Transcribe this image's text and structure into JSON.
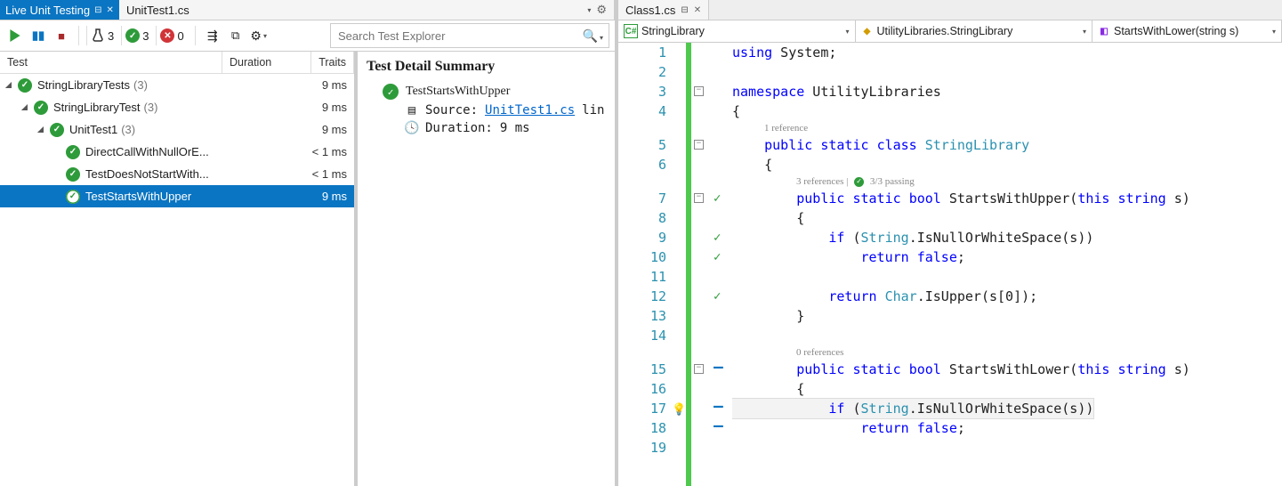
{
  "tabs": {
    "left_active": "Live Unit Testing",
    "left_inactive": "UnitTest1.cs",
    "right_file": "Class1.cs"
  },
  "toolbar": {
    "flask_count": "3",
    "pass_count": "3",
    "fail_count": "0"
  },
  "search": {
    "placeholder": "Search Test Explorer"
  },
  "tree_headers": {
    "test": "Test",
    "duration": "Duration",
    "traits": "Traits"
  },
  "tree": [
    {
      "indent": 0,
      "expand": true,
      "label": "StringLibraryTests",
      "count": "(3)",
      "duration": "9 ms",
      "selected": false
    },
    {
      "indent": 1,
      "expand": true,
      "label": "StringLibraryTest",
      "count": "(3)",
      "duration": "9 ms",
      "selected": false
    },
    {
      "indent": 2,
      "expand": true,
      "label": "UnitTest1",
      "count": "(3)",
      "duration": "9 ms",
      "selected": false
    },
    {
      "indent": 3,
      "expand": false,
      "label": "DirectCallWithNullOrE...",
      "count": "",
      "duration": "< 1 ms",
      "selected": false
    },
    {
      "indent": 3,
      "expand": false,
      "label": "TestDoesNotStartWith...",
      "count": "",
      "duration": "< 1 ms",
      "selected": false
    },
    {
      "indent": 3,
      "expand": false,
      "label": "TestStartsWithUpper",
      "count": "",
      "duration": "9 ms",
      "selected": true
    }
  ],
  "detail": {
    "title": "Test Detail Summary",
    "test_name": "TestStartsWithUpper",
    "source_label": "Source:",
    "source_link": "UnitTest1.cs",
    "source_suffix": "lin",
    "duration_label": "Duration:",
    "duration_value": "9 ms"
  },
  "navbar": {
    "seg1": "StringLibrary",
    "seg2": "UtilityLibraries.StringLibrary",
    "seg3": "StartsWithLower(string s)"
  },
  "code": {
    "lines": [
      {
        "n": 1,
        "fold": "",
        "mark": "",
        "html": "<span class='kw'>using</span> System;"
      },
      {
        "n": 2,
        "fold": "",
        "mark": "",
        "html": ""
      },
      {
        "n": 3,
        "fold": "box",
        "mark": "",
        "html": "<span class='kw'>namespace</span> UtilityLibraries"
      },
      {
        "n": 4,
        "fold": "",
        "mark": "",
        "html": "{"
      },
      {
        "lens": "1 reference",
        "indent": 4
      },
      {
        "n": 5,
        "fold": "box",
        "mark": "",
        "html": "    <span class='kw'>public</span> <span class='kw'>static</span> <span class='kw'>class</span> <span class='cls'>StringLibrary</span>"
      },
      {
        "n": 6,
        "fold": "",
        "mark": "",
        "html": "    {"
      },
      {
        "lens": "3 references | ✓ 3/3 passing",
        "indent": 8,
        "pass": true
      },
      {
        "n": 7,
        "fold": "box",
        "mark": "ok",
        "html": "        <span class='kw'>public</span> <span class='kw'>static</span> <span class='kw'>bool</span> StartsWithUpper(<span class='kw'>this</span> <span class='kw'>string</span> s)"
      },
      {
        "n": 8,
        "fold": "",
        "mark": "",
        "html": "        {"
      },
      {
        "n": 9,
        "fold": "",
        "mark": "ok",
        "html": "            <span class='kw'>if</span> (<span class='typ'>String</span>.IsNullOrWhiteSpace(s))"
      },
      {
        "n": 10,
        "fold": "",
        "mark": "ok",
        "html": "                <span class='kw'>return</span> <span class='kw'>false</span>;"
      },
      {
        "n": 11,
        "fold": "",
        "mark": "",
        "html": ""
      },
      {
        "n": 12,
        "fold": "",
        "mark": "ok",
        "html": "            <span class='kw'>return</span> <span class='typ'>Char</span>.IsUpper(s[0]);"
      },
      {
        "n": 13,
        "fold": "",
        "mark": "",
        "html": "        }"
      },
      {
        "n": 14,
        "fold": "",
        "mark": "",
        "html": ""
      },
      {
        "lens": "0 references",
        "indent": 8
      },
      {
        "n": 15,
        "fold": "box",
        "mark": "dash",
        "html": "        <span class='kw'>public</span> <span class='kw'>static</span> <span class='kw'>bool</span> StartsWithLower(<span class='kw'>this</span> <span class='kw'>string</span> s)"
      },
      {
        "n": 16,
        "fold": "",
        "mark": "",
        "html": "        {"
      },
      {
        "n": 17,
        "fold": "",
        "mark": "dash",
        "bulb": true,
        "highlight": true,
        "html": "            <span class='kw'>if</span> (<span class='typ'>String</span>.IsNullOrWhiteSpace(s))"
      },
      {
        "n": 18,
        "fold": "",
        "mark": "dash",
        "html": "                <span class='kw'>return</span> <span class='kw'>false</span>;"
      },
      {
        "n": 19,
        "fold": "",
        "mark": "",
        "html": ""
      }
    ]
  }
}
